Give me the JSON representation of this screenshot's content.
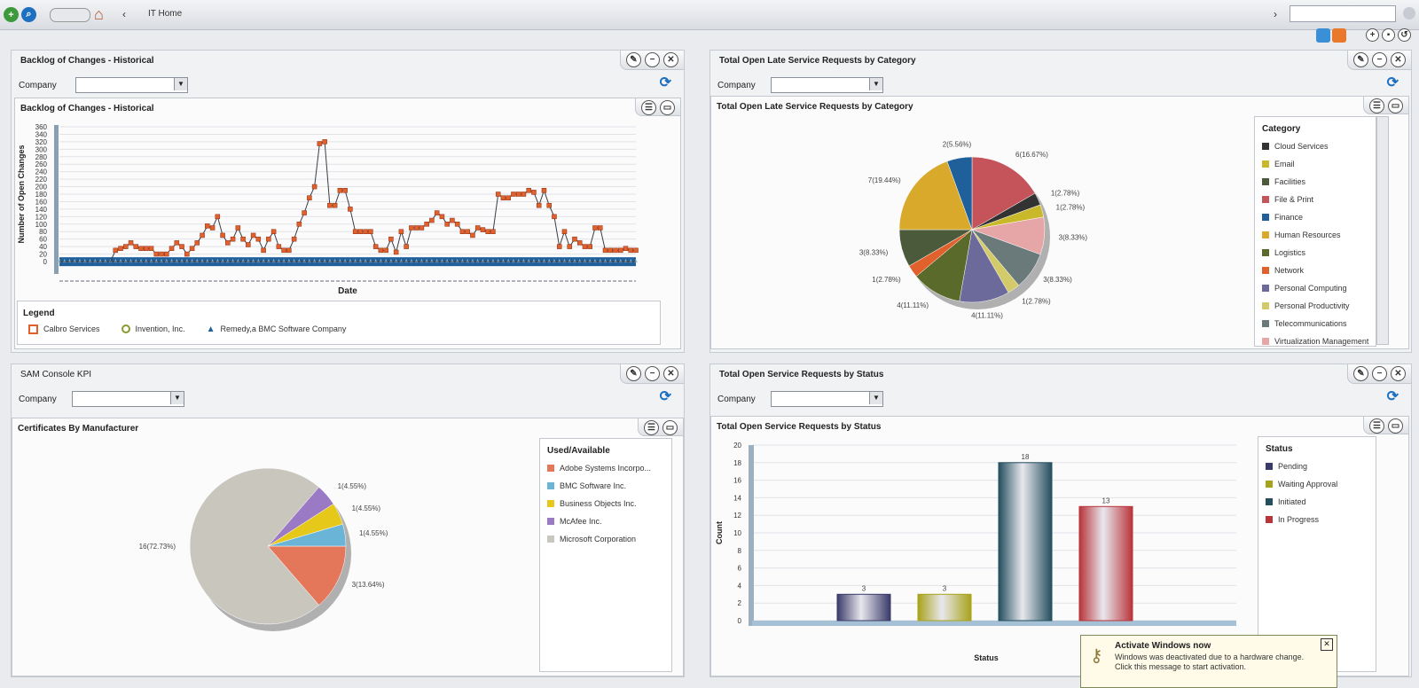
{
  "topbar": {
    "breadcrumb": "IT Home",
    "nav_arrow": "‹",
    "right_arrow": "›"
  },
  "common": {
    "company_label": "Company"
  },
  "backlog": {
    "outer_title": "Backlog of Changes - Historical",
    "inner_title": "Backlog of Changes - Historical",
    "legend_title": "Legend",
    "legend": [
      {
        "label": "Calbro Services",
        "color": "#e0612b"
      },
      {
        "label": "Invention, Inc.",
        "color": "#8a9a2a"
      },
      {
        "label": "Remedy,a BMC Software Company",
        "color": "#1f5f9a"
      }
    ]
  },
  "late": {
    "outer_title": "Total Open Late Service Requests by Category",
    "inner_title": "Total Open Late Service Requests by Category",
    "legend_title": "Category",
    "legend": [
      {
        "label": "Cloud Services",
        "color": "#333333"
      },
      {
        "label": "Email",
        "color": "#c9b92a"
      },
      {
        "label": "Facilities",
        "color": "#4a5a3a"
      },
      {
        "label": "File & Print",
        "color": "#c4545a"
      },
      {
        "label": "Finance",
        "color": "#1f5f9a"
      },
      {
        "label": "Human Resources",
        "color": "#d8a92a"
      },
      {
        "label": "Logistics",
        "color": "#5a6a2a"
      },
      {
        "label": "Network",
        "color": "#e0612b"
      },
      {
        "label": "Personal Computing",
        "color": "#6b6a9a"
      },
      {
        "label": "Personal Productivity",
        "color": "#d3cb6a"
      },
      {
        "label": "Telecommunications",
        "color": "#6a7a7a"
      },
      {
        "label": "Virtualization Management",
        "color": "#e6a6a8"
      }
    ]
  },
  "sam": {
    "outer_title": "SAM Console KPI",
    "inner_title": "Certificates By Manufacturer",
    "legend_title": "Used/Available",
    "legend": [
      {
        "label": "Adobe Systems Incorpo...",
        "color": "#e4765a"
      },
      {
        "label": "BMC Software Inc.",
        "color": "#6ab4d8"
      },
      {
        "label": "Business Objects Inc.",
        "color": "#e6c81a"
      },
      {
        "label": "McAfee Inc.",
        "color": "#9a7ac4"
      },
      {
        "label": "Microsoft Corporation",
        "color": "#c9c6bd"
      }
    ]
  },
  "status": {
    "outer_title": "Total Open Service Requests by Status",
    "inner_title": "Total Open Service Requests by Status",
    "legend_title": "Status",
    "legend": [
      {
        "label": "Pending",
        "color": "#3a3a6a"
      },
      {
        "label": "Waiting Approval",
        "color": "#a8a21a"
      },
      {
        "label": "Initiated",
        "color": "#244e5e"
      },
      {
        "label": "In Progress",
        "color": "#b8343a"
      }
    ]
  },
  "toast": {
    "title": "Activate Windows now",
    "message": "Windows was deactivated due to a hardware change. Click this message to start activation."
  },
  "chart_data": [
    {
      "type": "line",
      "title": "Backlog of Changes - Historical",
      "xlabel": "Date",
      "ylabel": "Number of Open Changes",
      "ylim": [
        0,
        360
      ],
      "yticks": [
        0,
        20,
        40,
        60,
        80,
        100,
        120,
        140,
        160,
        180,
        200,
        220,
        240,
        260,
        280,
        300,
        320,
        340,
        360
      ],
      "series": [
        {
          "name": "Calbro Services",
          "values": [
            0,
            0,
            0,
            0,
            0,
            0,
            0,
            0,
            0,
            0,
            0,
            30,
            35,
            40,
            50,
            40,
            35,
            35,
            35,
            20,
            20,
            20,
            35,
            50,
            40,
            20,
            35,
            50,
            70,
            95,
            90,
            120,
            70,
            50,
            60,
            90,
            60,
            45,
            70,
            60,
            30,
            60,
            80,
            40,
            30,
            30,
            60,
            100,
            130,
            170,
            200,
            315,
            320,
            150,
            150,
            190,
            190,
            140,
            80,
            80,
            80,
            80,
            40,
            30,
            30,
            60,
            25,
            80,
            40,
            90,
            90,
            90,
            100,
            110,
            130,
            120,
            100,
            110,
            100,
            80,
            80,
            70,
            90,
            85,
            80,
            80,
            180,
            170,
            170,
            180,
            180,
            180,
            190,
            185,
            150,
            190,
            150,
            120,
            40,
            80,
            40,
            60,
            50,
            40,
            40,
            90,
            90,
            30,
            30,
            30,
            30,
            35,
            30,
            30
          ]
        },
        {
          "name": "Invention, Inc.",
          "values": [
            0,
            0,
            0,
            0,
            0,
            0,
            0,
            0,
            0,
            0,
            0,
            0,
            0,
            0,
            0,
            0,
            0,
            0,
            0,
            0,
            0,
            0,
            0,
            0,
            0,
            0,
            0,
            0,
            0,
            0,
            0,
            0,
            0,
            0,
            0,
            0,
            0,
            0,
            0,
            0,
            0,
            0,
            0,
            0,
            0,
            0,
            0,
            0,
            0,
            0,
            0,
            0,
            0,
            0,
            0,
            0,
            0,
            0,
            0,
            0,
            0,
            0,
            0,
            0,
            0,
            0,
            0,
            0,
            0,
            0,
            0,
            0,
            0,
            0,
            0,
            0,
            0,
            0,
            0,
            0,
            0,
            0,
            0,
            0,
            0,
            0,
            0,
            0,
            0,
            0,
            0,
            0,
            0,
            0,
            0,
            0,
            0,
            0,
            0,
            0,
            0,
            0,
            0,
            0,
            0,
            0,
            0,
            0,
            0,
            0,
            0,
            0,
            0,
            0
          ]
        },
        {
          "name": "Remedy,a BMC Software Company",
          "values": [
            2,
            2,
            2,
            2,
            2,
            2,
            2,
            2,
            2,
            2,
            2,
            2,
            2,
            2,
            2,
            2,
            2,
            2,
            2,
            2,
            2,
            2,
            2,
            2,
            2,
            2,
            2,
            2,
            2,
            2,
            2,
            2,
            2,
            2,
            2,
            2,
            2,
            2,
            2,
            2,
            2,
            2,
            2,
            2,
            2,
            2,
            2,
            2,
            2,
            2,
            2,
            2,
            2,
            2,
            2,
            2,
            2,
            2,
            2,
            2,
            2,
            2,
            2,
            2,
            2,
            2,
            2,
            2,
            2,
            2,
            2,
            2,
            2,
            2,
            2,
            2,
            2,
            2,
            2,
            2,
            2,
            2,
            2,
            2,
            2,
            2,
            2,
            2,
            2,
            2,
            2,
            2,
            2,
            2,
            2,
            2,
            2,
            2,
            2,
            2,
            2,
            2,
            2,
            2,
            2,
            2,
            2,
            2,
            2,
            2,
            2,
            2,
            2,
            2
          ]
        }
      ],
      "legend": "bottom"
    },
    {
      "type": "pie",
      "title": "Total Open Late Service Requests by Category",
      "slices": [
        {
          "category": "File & Print",
          "value": 6,
          "label": "6(16.67%)"
        },
        {
          "category": "Cloud Services",
          "value": 1,
          "label": "1(2.78%)"
        },
        {
          "category": "Email",
          "value": 1,
          "label": "1(2.78%)"
        },
        {
          "category": "Virtualization Management",
          "value": 3,
          "label": "3(8.33%)"
        },
        {
          "category": "Telecommunications",
          "value": 3,
          "label": "3(8.33%)"
        },
        {
          "category": "Personal Productivity",
          "value": 1,
          "label": "1(2.78%)"
        },
        {
          "category": "Personal Computing",
          "value": 4,
          "label": "4(11.11%)"
        },
        {
          "category": "Logistics",
          "value": 4,
          "label": "4(11.11%)"
        },
        {
          "category": "Network",
          "value": 1,
          "label": "1(2.78%)"
        },
        {
          "category": "Facilities",
          "value": 3,
          "label": "3(8.33%)"
        },
        {
          "category": "Human Resources",
          "value": 7,
          "label": "7(19.44%)"
        },
        {
          "category": "Finance",
          "value": 2,
          "label": "2(5.56%)"
        }
      ],
      "legend": "right"
    },
    {
      "type": "pie",
      "title": "Certificates By Manufacturer",
      "slices": [
        {
          "category": "Adobe Systems Incorpo...",
          "value": 3,
          "label": "3(13.64%)"
        },
        {
          "category": "Microsoft Corporation",
          "value": 16,
          "label": "16(72.73%)"
        },
        {
          "category": "McAfee Inc.",
          "value": 1,
          "label": "1(4.55%)"
        },
        {
          "category": "Business Objects Inc.",
          "value": 1,
          "label": "1(4.55%)"
        },
        {
          "category": "BMC Software Inc.",
          "value": 1,
          "label": "1(4.55%)"
        }
      ],
      "legend": "right"
    },
    {
      "type": "bar",
      "title": "Total Open Service Requests by Status",
      "categories": [
        "Pending",
        "Waiting Approval",
        "Initiated",
        "In Progress"
      ],
      "values": [
        3,
        3,
        18,
        13
      ],
      "xlabel": "Status",
      "ylabel": "Count",
      "ylim": [
        0,
        20
      ],
      "yticks": [
        0,
        2,
        4,
        6,
        8,
        10,
        12,
        14,
        16,
        18,
        20
      ],
      "legend": "right"
    }
  ]
}
